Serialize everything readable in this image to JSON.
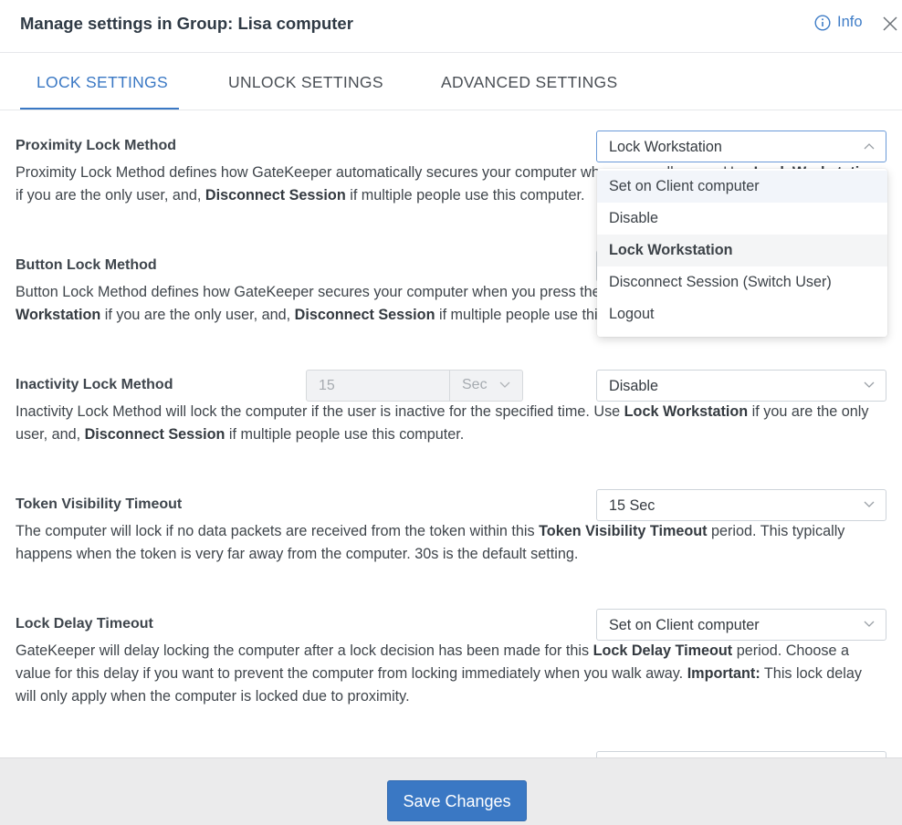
{
  "header": {
    "title": "Manage settings in Group: Lisa computer",
    "info_label": "Info"
  },
  "tabs": [
    {
      "label": "LOCK SETTINGS",
      "active": true
    },
    {
      "label": "UNLOCK SETTINGS",
      "active": false
    },
    {
      "label": "ADVANCED SETTINGS",
      "active": false
    }
  ],
  "sections": {
    "proximity": {
      "title": "Proximity Lock Method",
      "select_value": "Lock Workstation",
      "desc_a": "Proximity Lock Method defines how GateKeeper automatically secures your computer when you walk away. Use ",
      "desc_b": "Lock Workstation",
      "desc_c": " if you are the only user, and, ",
      "desc_d": "Disconnect Session",
      "desc_e": " if multiple people use this computer."
    },
    "button": {
      "title": "Button Lock Method",
      "desc_a": "Button Lock Method defines how GateKeeper secures your computer when you press the button on the token or the app. Use ",
      "desc_b": "Lock Workstation",
      "desc_c": " if you are the only user, and, ",
      "desc_d": "Disconnect Session",
      "desc_e": " if multiple people use this computer."
    },
    "inactivity": {
      "title": "Inactivity Lock Method",
      "number_value": "15",
      "unit_value": "Sec",
      "select_value": "Disable",
      "desc_a": "Inactivity Lock Method will lock the computer if the user is inactive for the specified time. Use ",
      "desc_b": "Lock Workstation",
      "desc_c": " if you are the only user, and, ",
      "desc_d": "Disconnect Session",
      "desc_e": " if multiple people use this computer."
    },
    "token": {
      "title": "Token Visibility Timeout",
      "select_value": "15 Sec",
      "desc_a": "The computer will lock if no data packets are received from the token within this ",
      "desc_b": "Token Visibility Timeout",
      "desc_c": " period. This typically happens when the token is very far away from the computer. 30s is the default setting."
    },
    "delay": {
      "title": "Lock Delay Timeout",
      "select_value": "Set on Client computer",
      "desc_a": "GateKeeper will delay locking the computer after a lock decision has been made for this ",
      "desc_b": "Lock Delay Timeout",
      "desc_c": " period. Choose a value for this delay if you want to prevent the computer from locking immediately when you walk away. ",
      "desc_d": "Important:",
      "desc_e": " This lock delay will only apply when the computer is locked due to proximity."
    }
  },
  "dropdown": {
    "options": [
      "Set on Client computer",
      "Disable",
      "Lock Workstation",
      "Disconnect Session (Switch User)",
      "Logout"
    ],
    "selected": "Lock Workstation",
    "hovered": "Set on Client computer"
  },
  "footer": {
    "save_label": "Save Changes"
  },
  "colors": {
    "accent": "#3a78c4",
    "footer_bg": "#ebebec"
  }
}
